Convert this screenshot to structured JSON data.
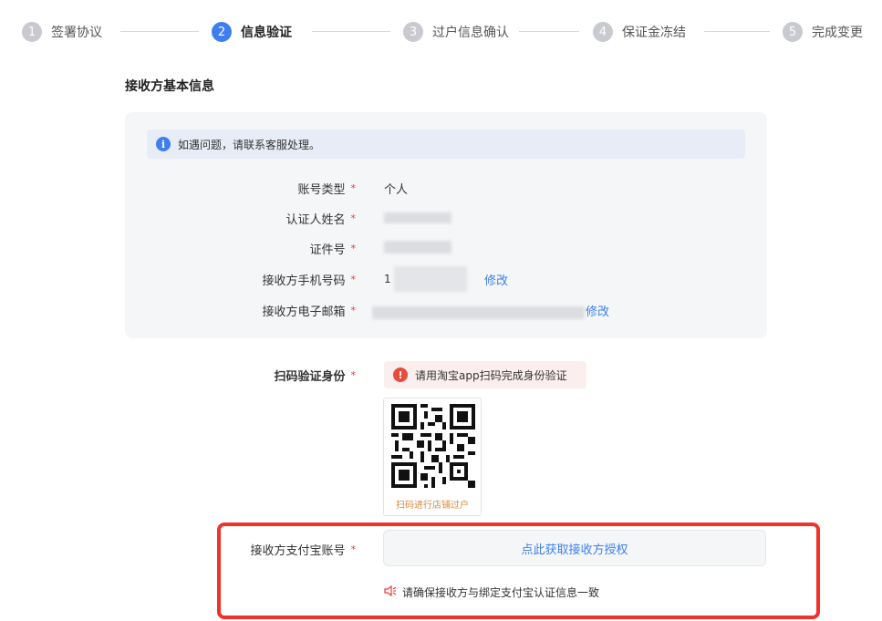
{
  "steps": [
    {
      "num": "1",
      "label": "签署协议"
    },
    {
      "num": "2",
      "label": "信息验证"
    },
    {
      "num": "3",
      "label": "过户信息确认"
    },
    {
      "num": "4",
      "label": "保证金冻结"
    },
    {
      "num": "5",
      "label": "完成变更"
    }
  ],
  "section_title": "接收方基本信息",
  "notice": {
    "icon": "i",
    "text": "如遇问题，请联系客服处理。"
  },
  "fields": {
    "account_type": {
      "label": "账号类型",
      "value": "个人"
    },
    "cert_name": {
      "label": "认证人姓名"
    },
    "id_number": {
      "label": "证件号"
    },
    "phone": {
      "label": "接收方手机号码",
      "value_prefix": "1",
      "action": "修改"
    },
    "email": {
      "label": "接收方电子邮箱",
      "action": "修改"
    }
  },
  "required_mark": "*",
  "scan": {
    "label": "扫码验证身份",
    "warning_icon": "!",
    "warning": "请用淘宝app扫码完成身份验证",
    "qr_caption": "扫码进行店铺过户"
  },
  "alipay": {
    "label": "接收方支付宝账号",
    "button": "点此获取接收方授权",
    "tip_icon": "speaker-icon",
    "tip": "请确保接收方与绑定支付宝认证信息一致"
  },
  "colors": {
    "accent": "#3d7ff0",
    "required": "#e53935",
    "highlight": "#f0322b"
  }
}
